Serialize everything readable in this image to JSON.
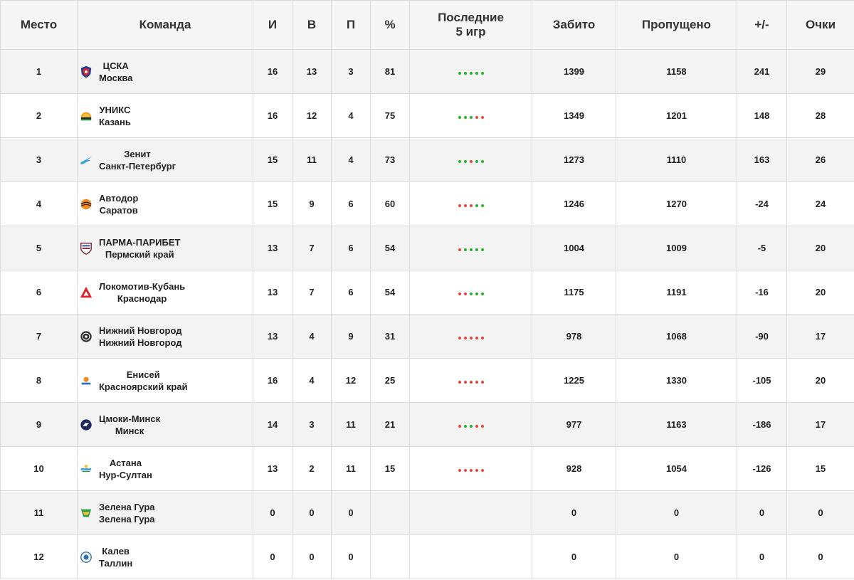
{
  "colors": {
    "win": "#22b527",
    "loss": "#e4473a"
  },
  "header": {
    "place": "Место",
    "team": "Команда",
    "games": "И",
    "wins": "В",
    "losses": "П",
    "percent": "%",
    "last5_line1": "Последние",
    "last5_line2": "5 игр",
    "scored": "Забито",
    "conceded": "Пропущено",
    "diff": "+/-",
    "points": "Очки"
  },
  "rows": [
    {
      "place": "1",
      "name": "ЦСКА",
      "city": "Москва",
      "logo": "cska-logo-icon",
      "games": "16",
      "wins": "13",
      "losses": "3",
      "percent": "81",
      "form": [
        "W",
        "W",
        "W",
        "W",
        "W"
      ],
      "scored": "1399",
      "conceded": "1158",
      "diff": "241",
      "points": "29"
    },
    {
      "place": "2",
      "name": "УНИКС",
      "city": "Казань",
      "logo": "unics-logo-icon",
      "games": "16",
      "wins": "12",
      "losses": "4",
      "percent": "75",
      "form": [
        "W",
        "W",
        "W",
        "L",
        "L"
      ],
      "scored": "1349",
      "conceded": "1201",
      "diff": "148",
      "points": "28"
    },
    {
      "place": "3",
      "name": "Зенит",
      "city": "Санкт-Петербург",
      "logo": "zenit-logo-icon",
      "games": "15",
      "wins": "11",
      "losses": "4",
      "percent": "73",
      "form": [
        "W",
        "W",
        "L",
        "W",
        "W"
      ],
      "scored": "1273",
      "conceded": "1110",
      "diff": "163",
      "points": "26"
    },
    {
      "place": "4",
      "name": "Автодор",
      "city": "Саратов",
      "logo": "avtodor-logo-icon",
      "games": "15",
      "wins": "9",
      "losses": "6",
      "percent": "60",
      "form": [
        "L",
        "L",
        "L",
        "W",
        "W"
      ],
      "scored": "1246",
      "conceded": "1270",
      "diff": "-24",
      "points": "24"
    },
    {
      "place": "5",
      "name": "ПАРМА-ПАРИБЕТ",
      "city": "Пермский край",
      "logo": "parma-logo-icon",
      "games": "13",
      "wins": "7",
      "losses": "6",
      "percent": "54",
      "form": [
        "L",
        "W",
        "W",
        "W",
        "W"
      ],
      "scored": "1004",
      "conceded": "1009",
      "diff": "-5",
      "points": "20"
    },
    {
      "place": "6",
      "name": "Локомотив-Кубань",
      "city": "Краснодар",
      "logo": "lokomotiv-logo-icon",
      "games": "13",
      "wins": "7",
      "losses": "6",
      "percent": "54",
      "form": [
        "L",
        "L",
        "W",
        "W",
        "W"
      ],
      "scored": "1175",
      "conceded": "1191",
      "diff": "-16",
      "points": "20"
    },
    {
      "place": "7",
      "name": "Нижний Новгород",
      "city": "Нижний Новгород",
      "logo": "nizhny-logo-icon",
      "games": "13",
      "wins": "4",
      "losses": "9",
      "percent": "31",
      "form": [
        "L",
        "L",
        "L",
        "L",
        "L"
      ],
      "scored": "978",
      "conceded": "1068",
      "diff": "-90",
      "points": "17"
    },
    {
      "place": "8",
      "name": "Енисей",
      "city": "Красноярский край",
      "logo": "enisey-logo-icon",
      "games": "16",
      "wins": "4",
      "losses": "12",
      "percent": "25",
      "form": [
        "L",
        "L",
        "L",
        "L",
        "L"
      ],
      "scored": "1225",
      "conceded": "1330",
      "diff": "-105",
      "points": "20"
    },
    {
      "place": "9",
      "name": "Цмоки-Минск",
      "city": "Минск",
      "logo": "tsmoki-logo-icon",
      "games": "14",
      "wins": "3",
      "losses": "11",
      "percent": "21",
      "form": [
        "L",
        "W",
        "W",
        "L",
        "L"
      ],
      "scored": "977",
      "conceded": "1163",
      "diff": "-186",
      "points": "17"
    },
    {
      "place": "10",
      "name": "Астана",
      "city": "Нур-Султан",
      "logo": "astana-logo-icon",
      "games": "13",
      "wins": "2",
      "losses": "11",
      "percent": "15",
      "form": [
        "L",
        "L",
        "L",
        "L",
        "L"
      ],
      "scored": "928",
      "conceded": "1054",
      "diff": "-126",
      "points": "15"
    },
    {
      "place": "11",
      "name": "Зелена Гура",
      "city": "Зелена Гура",
      "logo": "zielona-gora-logo-icon",
      "games": "0",
      "wins": "0",
      "losses": "0",
      "percent": "",
      "form": [],
      "scored": "0",
      "conceded": "0",
      "diff": "0",
      "points": "0"
    },
    {
      "place": "12",
      "name": "Калев",
      "city": "Таллин",
      "logo": "kalev-logo-icon",
      "games": "0",
      "wins": "0",
      "losses": "0",
      "percent": "",
      "form": [],
      "scored": "0",
      "conceded": "0",
      "diff": "0",
      "points": "0"
    }
  ]
}
